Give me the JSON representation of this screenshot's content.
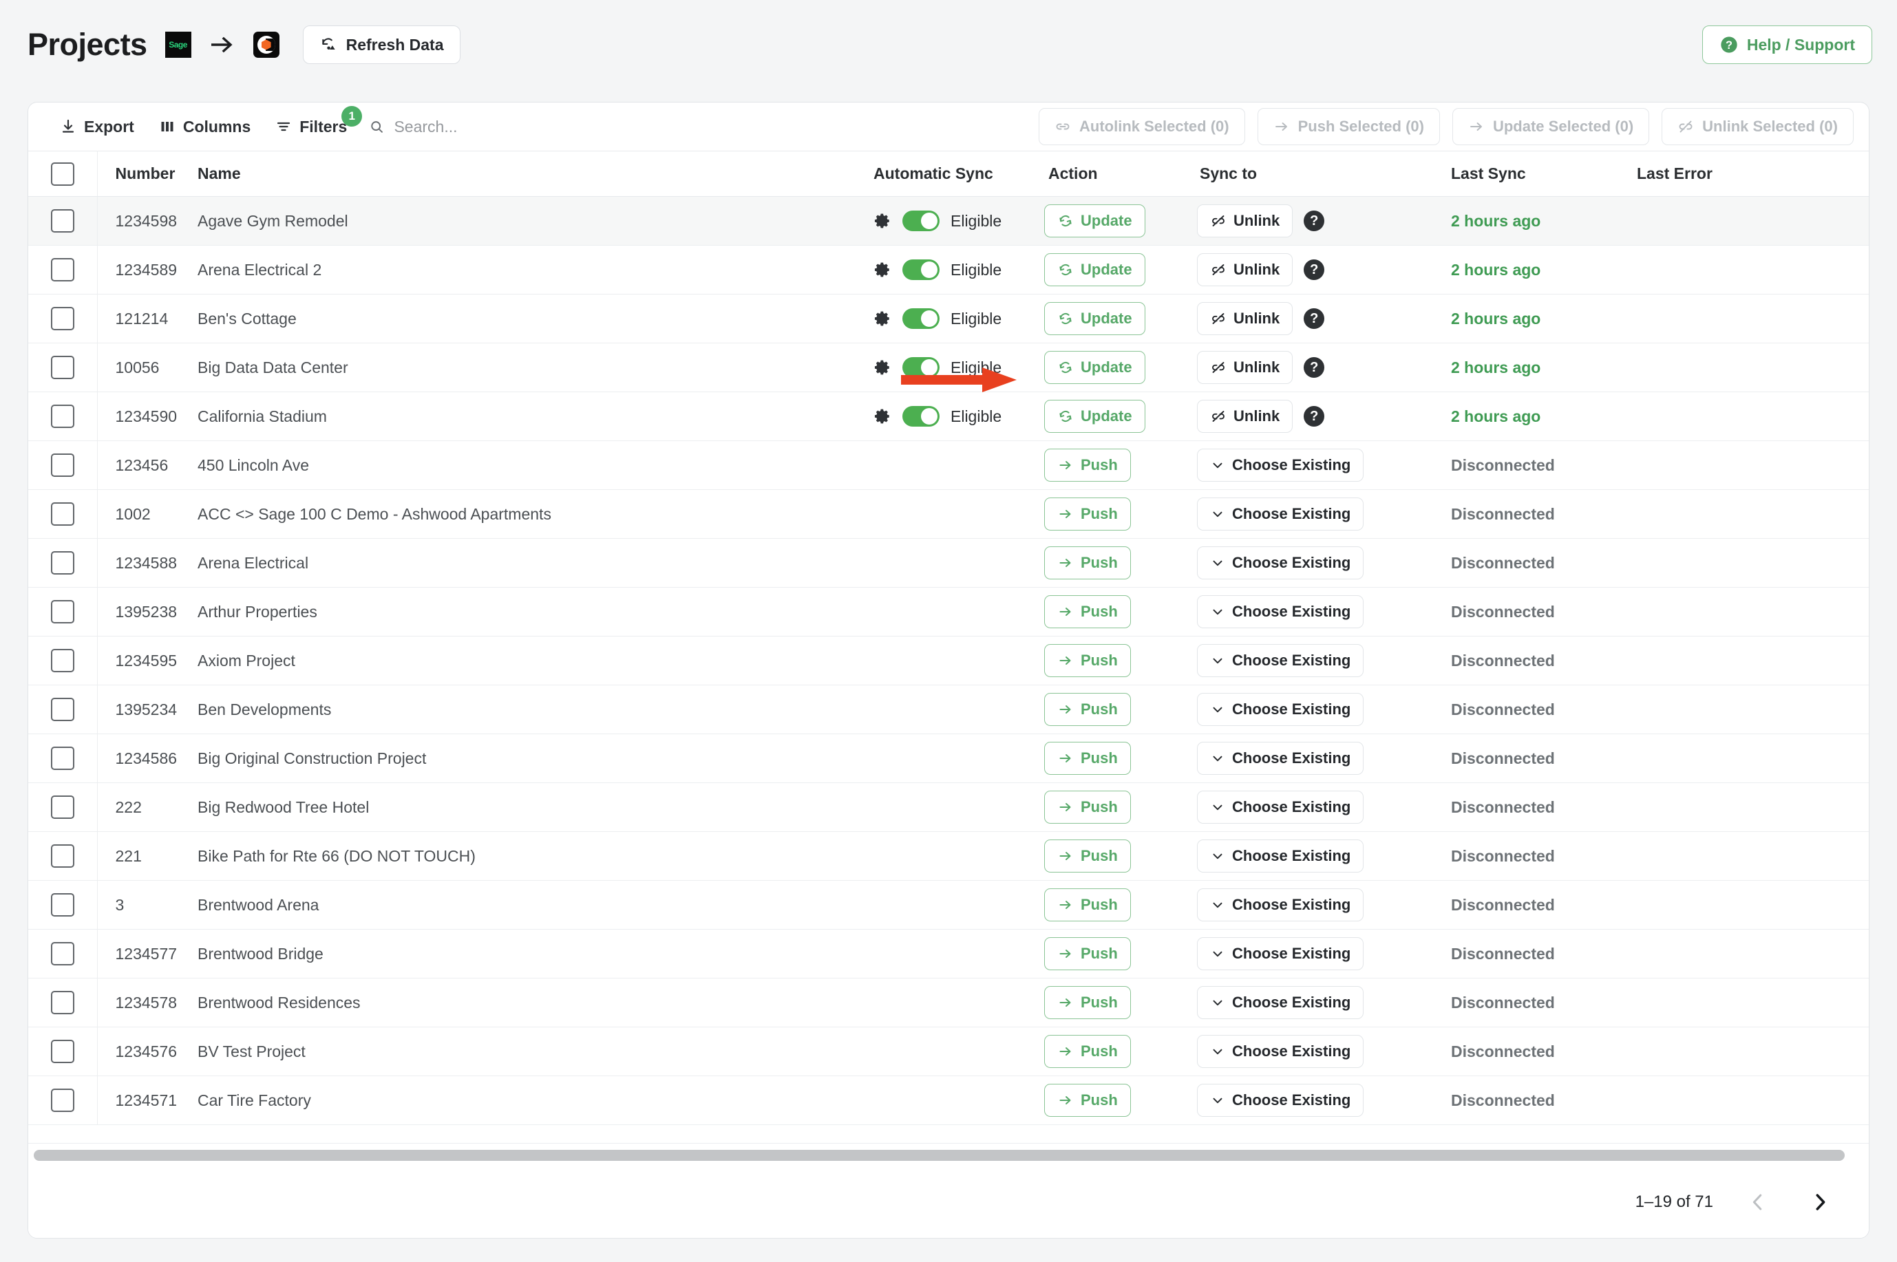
{
  "header": {
    "title": "Projects",
    "sage_logo_text": "Sage",
    "arrow_icon": "arrow-right-icon",
    "procore_logo_name": "procore-logo",
    "refresh_label": "Refresh Data",
    "refresh_icon": "refresh-data-icon",
    "help_label": "Help / Support",
    "help_icon": "question-circle-icon"
  },
  "toolbar": {
    "export_label": "Export",
    "export_icon": "download-icon",
    "columns_label": "Columns",
    "columns_icon": "columns-icon",
    "filters_label": "Filters",
    "filters_icon": "filter-icon",
    "filters_badge": "1",
    "search_placeholder": "Search...",
    "search_value": "",
    "search_icon": "search-icon",
    "bulk_actions": [
      {
        "label": "Autolink Selected (0)",
        "icon": "link-icon",
        "disabled": true
      },
      {
        "label": "Push Selected (0)",
        "icon": "arrow-right-icon",
        "disabled": true
      },
      {
        "label": "Update Selected (0)",
        "icon": "arrow-right-icon",
        "disabled": true
      },
      {
        "label": "Unlink Selected (0)",
        "icon": "link-off-icon",
        "disabled": true
      }
    ]
  },
  "table": {
    "columns": [
      "Number",
      "Name",
      "Automatic Sync",
      "Action",
      "Sync to",
      "Last Sync",
      "Last Error"
    ],
    "labels": {
      "eligible": "Eligible",
      "update": "Update",
      "unlink": "Unlink",
      "push": "Push",
      "choose_existing": "Choose Existing",
      "disconnected": "Disconnected",
      "help_mark": "?"
    },
    "rows": [
      {
        "number": "1234598",
        "name": "Agave Gym Remodel",
        "linked": true,
        "last_sync": "2 hours ago",
        "last_error": "",
        "highlight": true,
        "annotated": true
      },
      {
        "number": "1234589",
        "name": "Arena Electrical 2",
        "linked": true,
        "last_sync": "2 hours ago",
        "last_error": ""
      },
      {
        "number": "121214",
        "name": "Ben's Cottage",
        "linked": true,
        "last_sync": "2 hours ago",
        "last_error": ""
      },
      {
        "number": "10056",
        "name": "Big Data Data Center",
        "linked": true,
        "last_sync": "2 hours ago",
        "last_error": ""
      },
      {
        "number": "1234590",
        "name": "California Stadium",
        "linked": true,
        "last_sync": "2 hours ago",
        "last_error": ""
      },
      {
        "number": "123456",
        "name": "450 Lincoln Ave",
        "linked": false,
        "last_sync": "Disconnected",
        "last_error": ""
      },
      {
        "number": "1002",
        "name": "ACC <> Sage 100 C Demo - Ashwood Apartments",
        "linked": false,
        "last_sync": "Disconnected",
        "last_error": ""
      },
      {
        "number": "1234588",
        "name": "Arena Electrical",
        "linked": false,
        "last_sync": "Disconnected",
        "last_error": ""
      },
      {
        "number": "1395238",
        "name": "Arthur Properties",
        "linked": false,
        "last_sync": "Disconnected",
        "last_error": ""
      },
      {
        "number": "1234595",
        "name": "Axiom Project",
        "linked": false,
        "last_sync": "Disconnected",
        "last_error": ""
      },
      {
        "number": "1395234",
        "name": "Ben Developments",
        "linked": false,
        "last_sync": "Disconnected",
        "last_error": ""
      },
      {
        "number": "1234586",
        "name": "Big Original Construction Project",
        "linked": false,
        "last_sync": "Disconnected",
        "last_error": ""
      },
      {
        "number": "222",
        "name": "Big Redwood Tree Hotel",
        "linked": false,
        "last_sync": "Disconnected",
        "last_error": ""
      },
      {
        "number": "221",
        "name": "Bike Path for Rte 66 (DO NOT TOUCH)",
        "linked": false,
        "last_sync": "Disconnected",
        "last_error": ""
      },
      {
        "number": "3",
        "name": "Brentwood Arena",
        "linked": false,
        "last_sync": "Disconnected",
        "last_error": ""
      },
      {
        "number": "1234577",
        "name": "Brentwood Bridge",
        "linked": false,
        "last_sync": "Disconnected",
        "last_error": ""
      },
      {
        "number": "1234578",
        "name": "Brentwood Residences",
        "linked": false,
        "last_sync": "Disconnected",
        "last_error": ""
      },
      {
        "number": "1234576",
        "name": "BV Test Project",
        "linked": false,
        "last_sync": "Disconnected",
        "last_error": ""
      },
      {
        "number": "1234571",
        "name": "Car Tire Factory",
        "linked": false,
        "last_sync": "Disconnected",
        "last_error": ""
      }
    ]
  },
  "footer": {
    "page_info": "1–19 of 71",
    "prev_icon": "chevron-left-icon",
    "next_icon": "chevron-right-icon"
  },
  "colors": {
    "accent_green": "#4CAF50",
    "link_green": "#56A868",
    "annotation_red": "#E8401F",
    "procore_orange": "#F26722",
    "sage_green": "#2AD47C"
  }
}
